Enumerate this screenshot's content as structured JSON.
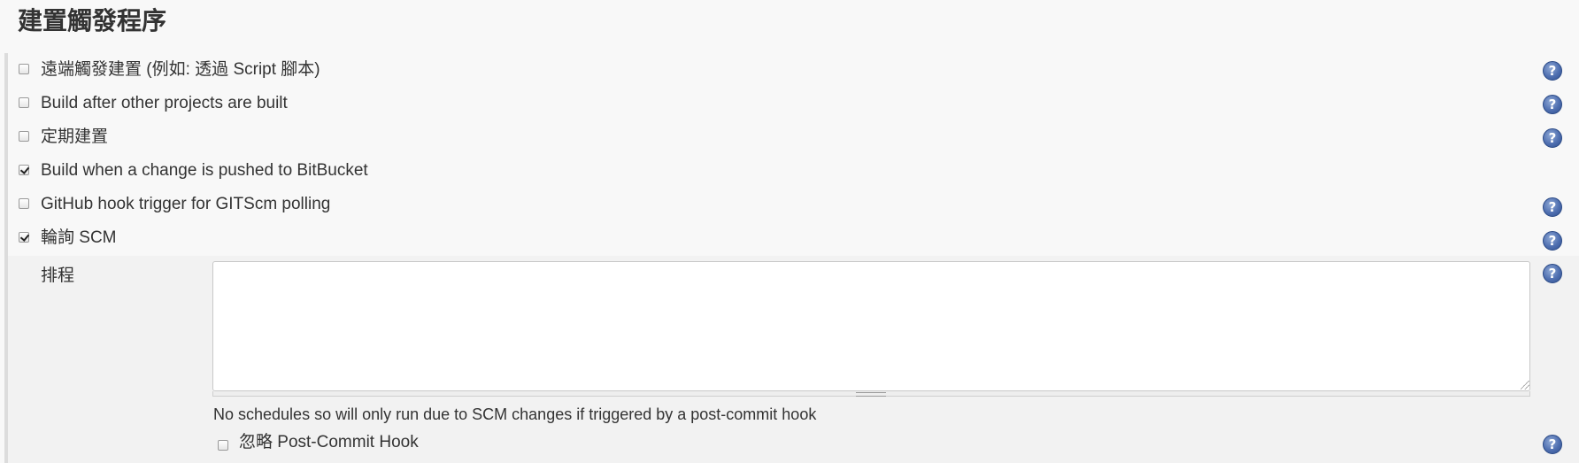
{
  "section": {
    "title": "建置觸發程序"
  },
  "options": [
    {
      "label": "遠端觸發建置 (例如: 透過 Script 腳本)",
      "checked": false,
      "has_help": true
    },
    {
      "label": "Build after other projects are built",
      "checked": false,
      "has_help": true
    },
    {
      "label": "定期建置",
      "checked": false,
      "has_help": true
    },
    {
      "label": "Build when a change is pushed to BitBucket",
      "checked": true,
      "has_help": false
    },
    {
      "label": "GitHub hook trigger for GITScm polling",
      "checked": false,
      "has_help": true
    },
    {
      "label": "輪詢 SCM",
      "checked": true,
      "has_help": true
    }
  ],
  "poll_scm": {
    "schedule_label": "排程",
    "schedule_value": "",
    "schedule_description": "No schedules so will only run due to SCM changes if triggered by a post-commit hook",
    "ignore_hook_label": "忽略 Post-Commit Hook",
    "ignore_hook_checked": false
  },
  "help_icon": {
    "glyph": "?",
    "icon": "help-question-icon",
    "color": "#4f6fb0"
  }
}
